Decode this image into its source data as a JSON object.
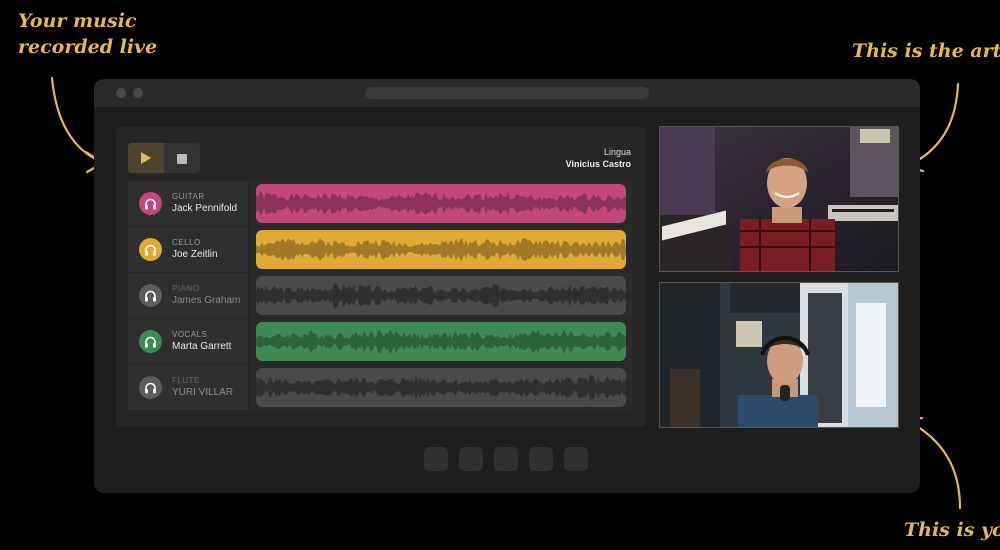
{
  "annotations": {
    "music": "Your music recorded live",
    "artist": "This is the artist",
    "you": "This is you"
  },
  "song": {
    "title": "Lingua",
    "artist": "Vinicius Castro"
  },
  "controls": {
    "play_icon": "play-icon",
    "stop_icon": "stop-icon"
  },
  "tracks": [
    {
      "instrument": "GUITAR",
      "player": "Jack Pennifold",
      "color": "#c2477a",
      "active": true
    },
    {
      "instrument": "CELLO",
      "player": "Joe Zeitlin",
      "color": "#e0aa36",
      "active": true
    },
    {
      "instrument": "PIANO",
      "player": "James Graham",
      "color": "#4a4a4a",
      "active": false
    },
    {
      "instrument": "VOCALS",
      "player": "Marta Garrett",
      "color": "#3f8a52",
      "active": true
    },
    {
      "instrument": "FLUTE",
      "player": "YURI VILLAR",
      "color": "#4a4a4a",
      "active": false
    }
  ],
  "colors": {
    "accent": "#e8b84a",
    "play_button_bg": "#4d4530"
  }
}
